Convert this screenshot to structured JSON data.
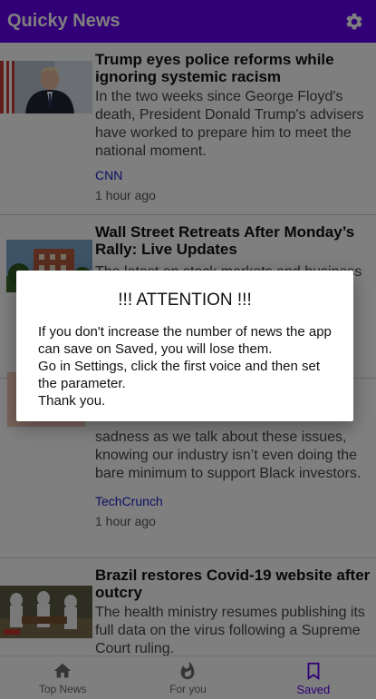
{
  "app": {
    "title": "Quicky News"
  },
  "articles": [
    {
      "title": "Trump eyes police reforms while ignoring systemic racism",
      "description": "In the two weeks since George Floyd's death, President Donald Trump's advisers have worked to prepare him to meet the national moment.",
      "source": "CNN",
      "time": "1 hour ago"
    },
    {
      "title": "Wall Street Retreats After Monday’s Rally: Live Updates",
      "description": "The latest on stock markets and business",
      "source": "",
      "time": ""
    },
    {
      "title": "",
      "description": "sadness as we talk about these issues, knowing our industry isn’t even doing the bare minimum to support Black investors.",
      "source": "TechCrunch",
      "time": "1 hour ago"
    },
    {
      "title": "Brazil restores Covid-19 website after outcry",
      "description": "The health ministry resumes publishing its full data on the virus following a Supreme Court ruling.",
      "source": "",
      "time": ""
    }
  ],
  "nav": {
    "items": [
      {
        "label": "Top News",
        "icon": "home-icon"
      },
      {
        "label": "For you",
        "icon": "flame-icon"
      },
      {
        "label": "Saved",
        "icon": "bookmark-icon"
      }
    ],
    "active": "Saved"
  },
  "dialog": {
    "title": "!!! ATTENTION !!!",
    "message": "If you don't increase the number of news the app can save on Saved, you will lose them.\nGo in Settings, click the first voice and then set the parameter.\nThank you."
  },
  "colors": {
    "primary": "#6200ee",
    "source_link": "#1a21c8"
  }
}
